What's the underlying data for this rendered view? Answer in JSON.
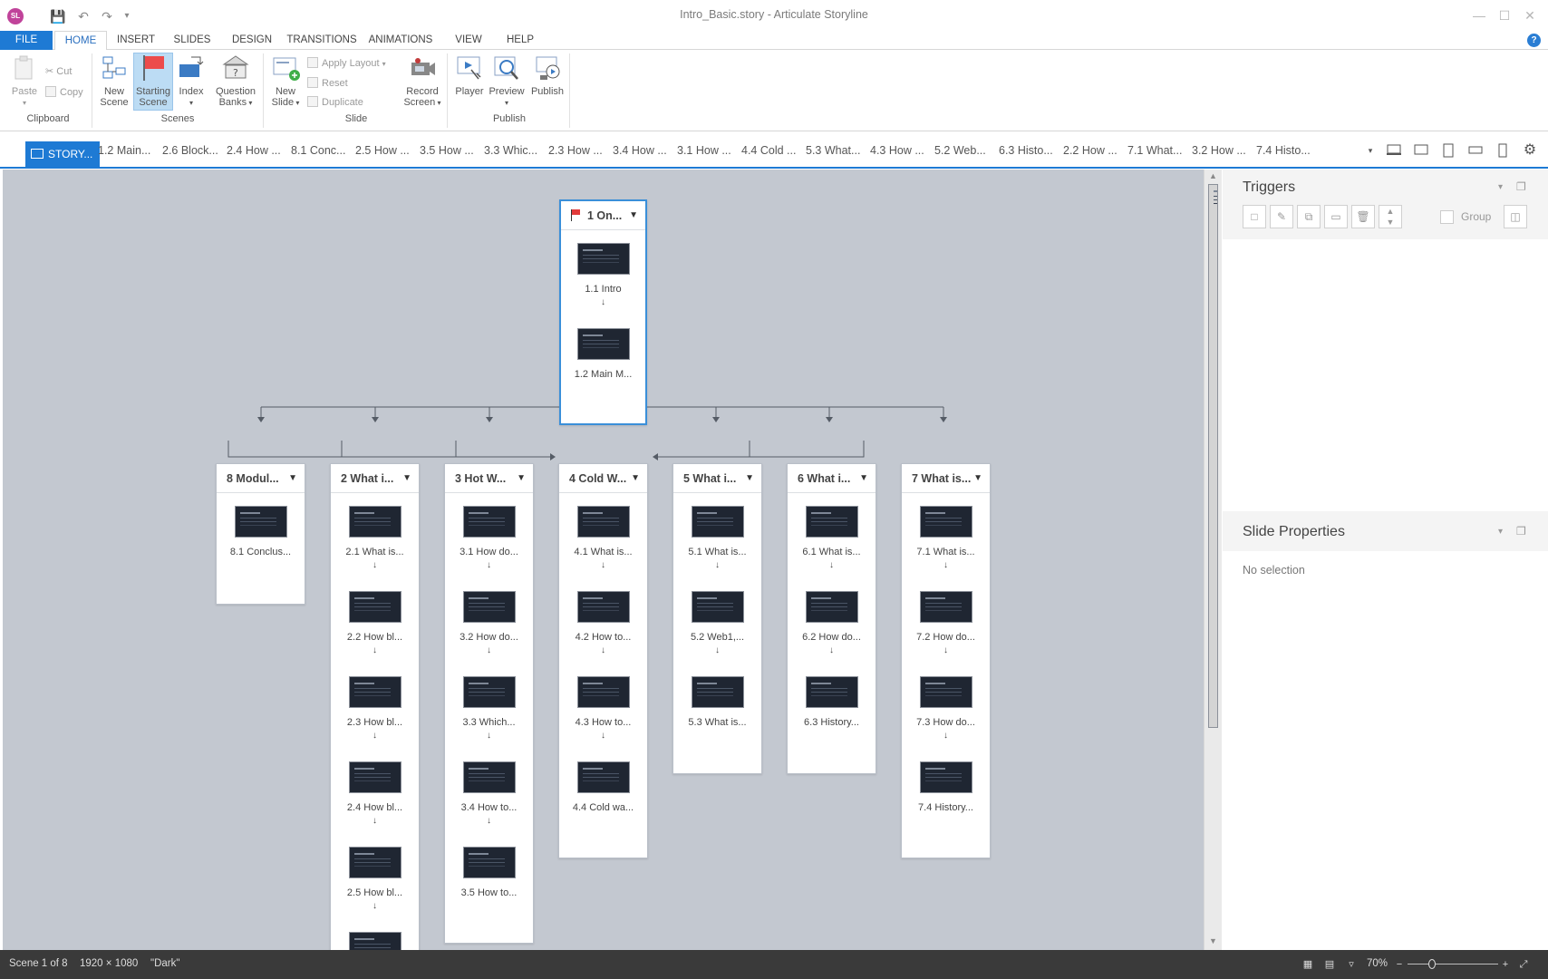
{
  "window": {
    "title": "Intro_Basic.story - Articulate Storyline",
    "logo_text": "SL"
  },
  "ribbon_tabs": [
    "FILE",
    "HOME",
    "INSERT",
    "SLIDES",
    "DESIGN",
    "TRANSITIONS",
    "ANIMATIONS",
    "VIEW",
    "HELP"
  ],
  "ribbon": {
    "clipboard": {
      "paste": "Paste",
      "cut": "Cut",
      "copy": "Copy",
      "group": "Clipboard"
    },
    "scenes": {
      "new_scene_1": "New",
      "new_scene_2": "Scene",
      "starting_1": "Starting",
      "starting_2": "Scene",
      "index": "Index",
      "qb_1": "Question",
      "qb_2": "Banks",
      "group": "Scenes"
    },
    "slide": {
      "new_1": "New",
      "new_2": "Slide",
      "apply_layout": "Apply Layout",
      "reset": "Reset",
      "duplicate": "Duplicate",
      "record_1": "Record",
      "record_2": "Screen",
      "group": "Slide"
    },
    "publish": {
      "player": "Player",
      "preview": "Preview",
      "publish": "Publish",
      "group": "Publish"
    }
  },
  "scene_tabs": {
    "story": "STORY...",
    "tabs": [
      "1.2 Main...",
      "2.6 Block...",
      "2.4 How ...",
      "8.1 Conc...",
      "2.5 How ...",
      "3.5 How ...",
      "3.3 Whic...",
      "2.3 How ...",
      "3.4 How ...",
      "3.1 How ...",
      "4.4 Cold ...",
      "5.3 What...",
      "4.3 How ...",
      "5.2 Web...",
      "6.3 Histo...",
      "2.2 How ...",
      "7.1 What...",
      "3.2 How ...",
      "7.4 Histo..."
    ]
  },
  "scenes": [
    {
      "title": "1 On...",
      "start": true,
      "slides": [
        "1.1 Intro",
        "1.2 Main M..."
      ]
    },
    {
      "title": "8 Modul...",
      "slides": [
        "8.1 Conclus..."
      ]
    },
    {
      "title": "2 What i...",
      "slides": [
        "2.1 What is...",
        "2.2 How bl...",
        "2.3 How bl...",
        "2.4 How bl...",
        "2.5 How bl..."
      ]
    },
    {
      "title": "3 Hot W...",
      "slides": [
        "3.1 How do...",
        "3.2 How do...",
        "3.3  Which...",
        "3.4 How to...",
        "3.5 How to..."
      ]
    },
    {
      "title": "4 Cold W...",
      "slides": [
        "4.1 What is...",
        "4.2 How to...",
        "4.3 How to...",
        "4.4 Cold wa..."
      ]
    },
    {
      "title": "5 What i...",
      "slides": [
        "5.1 What is...",
        "5.2 Web1,...",
        "5.3 What is..."
      ]
    },
    {
      "title": "6 What i...",
      "slides": [
        "6.1 What is...",
        "6.2 How do...",
        "6.3 History..."
      ]
    },
    {
      "title": "7 What is...",
      "slides": [
        "7.1 What is...",
        "7.2 How do...",
        "7.3 How do...",
        "7.4 History..."
      ]
    }
  ],
  "triggers_panel": {
    "title": "Triggers",
    "group_label": "Group"
  },
  "slide_properties": {
    "title": "Slide Properties",
    "empty": "No selection"
  },
  "status": {
    "scene": "Scene 1 of 8",
    "dimensions": "1920 × 1080",
    "theme": "\"Dark\"",
    "zoom": "70%"
  },
  "colors": {
    "accent": "#1e7ad4",
    "canvas": "#c3c8d0",
    "statusbar": "#3a3a3a"
  }
}
